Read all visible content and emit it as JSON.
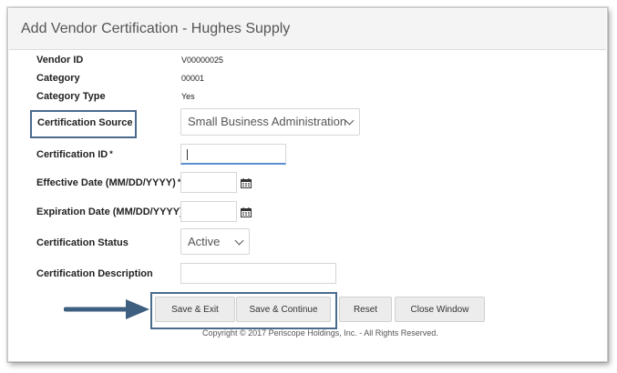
{
  "header": {
    "title": "Add Vendor Certification  -  Hughes Supply"
  },
  "fields": {
    "vendor_id": {
      "label": "Vendor ID",
      "value": "V00000025"
    },
    "category": {
      "label": "Category",
      "value": "00001"
    },
    "category_type": {
      "label": "Category Type",
      "value": "Yes"
    },
    "certification_source": {
      "label": "Certification Source",
      "value": "Small Business Administration"
    },
    "certification_id": {
      "label": "Certification ID",
      "required": "*"
    },
    "effective_date": {
      "label": "Effective Date (MM/DD/YYYY)",
      "required": "*"
    },
    "expiration_date": {
      "label": "Expiration Date (MM/DD/YYYY)"
    },
    "certification_status": {
      "label": "Certification Status",
      "value": "Active"
    },
    "certification_description": {
      "label": "Certification Description"
    }
  },
  "buttons": {
    "save_exit": "Save & Exit",
    "save_continue": "Save & Continue",
    "reset": "Reset",
    "close_window": "Close Window"
  },
  "footer": {
    "copyright": "Copyright © 2017 Periscope Holdings, Inc. - All Rights Reserved."
  },
  "icons": {
    "calendar": "calendar-icon",
    "chevron": "chevron-down-icon",
    "arrow": "arrow-right-icon"
  },
  "colors": {
    "highlight": "#4a6b8c",
    "input_focus": "#5c8fcf"
  }
}
